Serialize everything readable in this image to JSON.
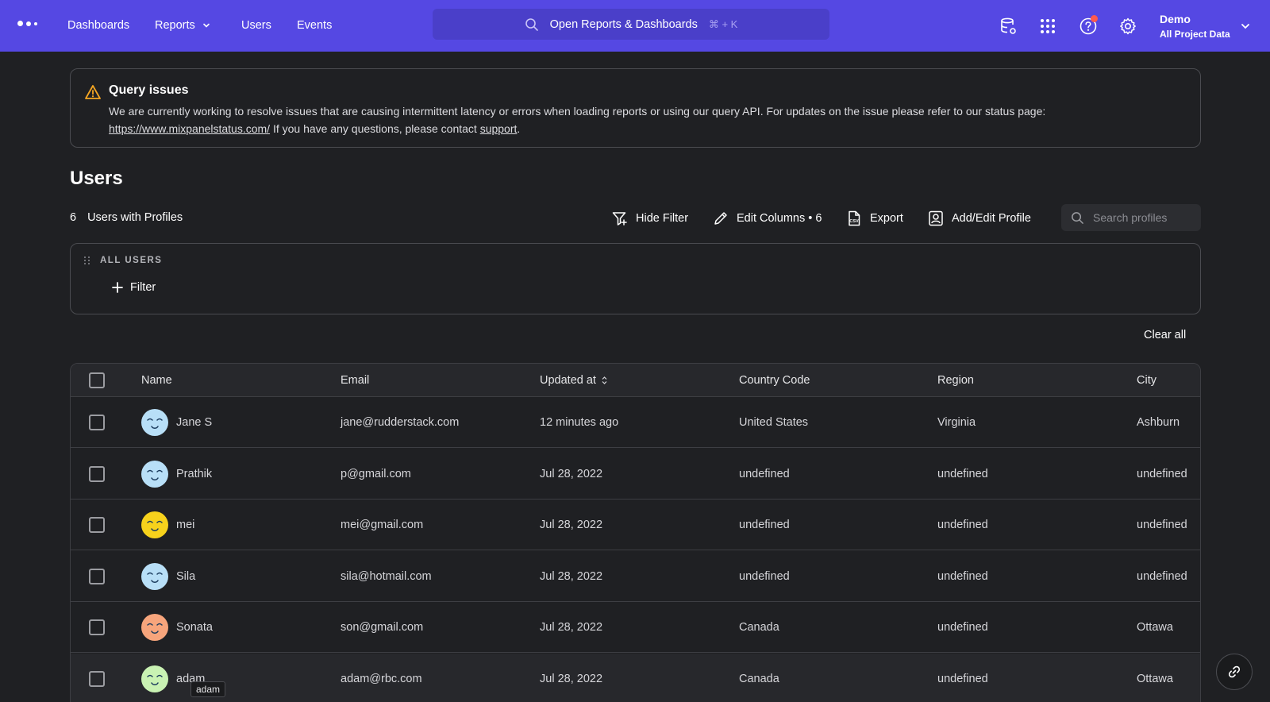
{
  "nav": {
    "links": [
      "Dashboards",
      "Reports",
      "Users",
      "Events"
    ],
    "search_label": "Open Reports & Dashboards",
    "search_shortcut": "⌘ + K",
    "project_name": "Demo",
    "project_scope": "All Project Data",
    "icons": [
      "data-management-icon",
      "apps-grid-icon",
      "help-icon",
      "settings-icon"
    ]
  },
  "banner": {
    "title": "Query issues",
    "text_1": "We are currently working to resolve issues that are causing intermittent latency or errors when loading reports or using our query API. For updates on the issue please refer to our status page:",
    "link": "https://www.mixpanelstatus.com/",
    "text_2": " If you have any questions, please contact ",
    "support": "support",
    "text_3": "."
  },
  "page": {
    "title": "Users",
    "count": "6",
    "count_label": "Users with Profiles"
  },
  "toolbar": {
    "hide_filter": "Hide Filter",
    "edit_columns": "Edit Columns • 6",
    "export": "Export",
    "add_edit_profile": "Add/Edit Profile",
    "search_placeholder": "Search profiles"
  },
  "filter": {
    "group_label": "ALL USERS",
    "add_filter": "Filter",
    "clear_all": "Clear all"
  },
  "table": {
    "columns": [
      "Name",
      "Email",
      "Updated at",
      "Country Code",
      "Region",
      "City"
    ],
    "rows": [
      {
        "name": "Jane S",
        "email": "jane@rudderstack.com",
        "updated": "12 minutes ago",
        "country": "United States",
        "region": "Virginia",
        "city": "Ashburn",
        "avatar_color": "#b8dff7"
      },
      {
        "name": "Prathik",
        "email": "p@gmail.com",
        "updated": "Jul 28, 2022",
        "country": "undefined",
        "region": "undefined",
        "city": "undefined",
        "avatar_color": "#b8dff7"
      },
      {
        "name": "mei",
        "email": "mei@gmail.com",
        "updated": "Jul 28, 2022",
        "country": "undefined",
        "region": "undefined",
        "city": "undefined",
        "avatar_color": "#f7d21c"
      },
      {
        "name": "Sila",
        "email": "sila@hotmail.com",
        "updated": "Jul 28, 2022",
        "country": "undefined",
        "region": "undefined",
        "city": "undefined",
        "avatar_color": "#b8dff7"
      },
      {
        "name": "Sonata",
        "email": "son@gmail.com",
        "updated": "Jul 28, 2022",
        "country": "Canada",
        "region": "undefined",
        "city": "Ottawa",
        "avatar_color": "#f7a57c"
      },
      {
        "name": "adam",
        "email": "adam@rbc.com",
        "updated": "Jul 28, 2022",
        "country": "Canada",
        "region": "undefined",
        "city": "Ottawa",
        "avatar_color": "#c9f2b3"
      }
    ]
  },
  "tooltip": "adam",
  "colors": {
    "nav_bg": "#5548e3",
    "page_bg": "#1f2023",
    "warning": "#f5a623",
    "notification": "#ff5a4d"
  }
}
